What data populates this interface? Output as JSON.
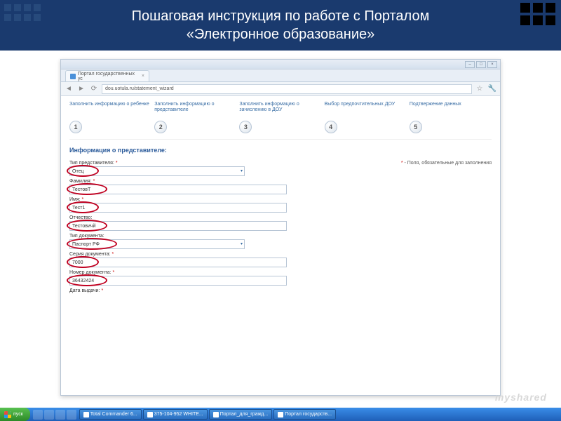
{
  "slide": {
    "title_line1": "Пошаговая инструкция по работе с Порталом",
    "title_line2": "«Электронное образование»"
  },
  "browser": {
    "tab_title": "Портал государственных ус",
    "url": "dou.uotula.ru/statement_wizard",
    "wm": {
      "min": "–",
      "max": "□",
      "close": "×"
    }
  },
  "wizard": {
    "steps": [
      {
        "num": "1",
        "label": "Заполнить информацию о ребенке"
      },
      {
        "num": "2",
        "label": "Заполнить информацию о представителе"
      },
      {
        "num": "3",
        "label": "Заполнить информацию о зачислению в ДОУ"
      },
      {
        "num": "4",
        "label": "Выбор предпочтительных ДОУ"
      },
      {
        "num": "5",
        "label": "Подтвержение данных"
      }
    ]
  },
  "section_title": "Информация о представителе:",
  "hint_prefix": "* ",
  "hint_text": "- Поля, обязательные для заполнения",
  "form": {
    "type_label": "Тип представителя:",
    "type_value": "Отец",
    "surname_label": "Фамилия:",
    "surname_value": "ТестовТ",
    "name_label": "Имя:",
    "name_value": "Тест1",
    "patronymic_label": "Отчество:",
    "patronymic_value": "Тестовичй",
    "doctype_label": "Тип документа:",
    "doctype_value": "Паспорт РФ",
    "docseries_label": "Серия документа:",
    "docseries_value": "7000",
    "docnum_label": "Номер документа:",
    "docnum_value": "36432424",
    "issuedate_label": "Дата выдачи:"
  },
  "taskbar": {
    "start": "пуск",
    "items": [
      "Total Commander 6...",
      "375-104-952 WHITE...",
      "Портал_для_гражд...",
      "Портал государств..."
    ]
  },
  "watermark": "myshared"
}
